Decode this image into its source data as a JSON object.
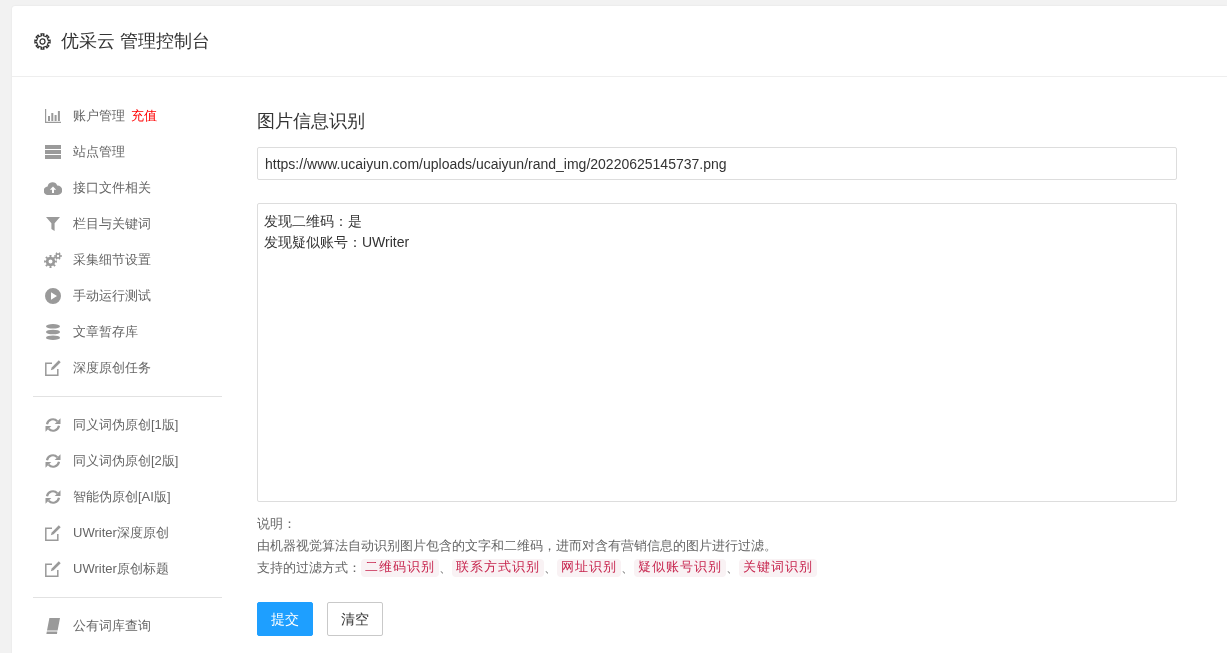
{
  "header": {
    "title": "优采云 管理控制台"
  },
  "sidebar": {
    "groups": [
      {
        "items": [
          {
            "label": "账户管理",
            "kind": "stats",
            "link": "充值"
          },
          {
            "label": "站点管理",
            "kind": "servers"
          },
          {
            "label": "接口文件相关",
            "kind": "upload"
          },
          {
            "label": "栏目与关键词",
            "kind": "filter"
          },
          {
            "label": "采集细节设置",
            "kind": "settings"
          },
          {
            "label": "手动运行测试",
            "kind": "run"
          },
          {
            "label": "文章暂存库",
            "kind": "storage"
          },
          {
            "label": "深度原创任务",
            "kind": "edit"
          }
        ]
      },
      {
        "items": [
          {
            "label": "同义词伪原创[1版]",
            "kind": "refresh"
          },
          {
            "label": "同义词伪原创[2版]",
            "kind": "refresh"
          },
          {
            "label": "智能伪原创[AI版]",
            "kind": "refresh"
          },
          {
            "label": "UWriter深度原创",
            "kind": "edit"
          },
          {
            "label": "UWriter原创标题",
            "kind": "edit"
          }
        ]
      },
      {
        "items": [
          {
            "label": "公有词库查询",
            "kind": "book"
          }
        ]
      }
    ]
  },
  "main": {
    "title": "图片信息识别",
    "url_field": {
      "value": "https://www.ucaiyun.com/uploads/ucaiyun/rand_img/20220625145737.png"
    },
    "result_box": {
      "lines": [
        "发现二维码：是",
        "发现疑似账号：UWriter"
      ]
    },
    "notes": {
      "heading": "说明：",
      "description": "由机器视觉算法自动识别图片包含的文字和二维码，进而对含有营销信息的图片进行过滤。",
      "filters_label": "支持的过滤方式：",
      "filters": [
        {
          "label": "二维码识别",
          "separator": "、"
        },
        {
          "label": "联系方式识别",
          "separator": "、"
        },
        {
          "label": "网址识别",
          "separator": "、"
        },
        {
          "label": "疑似账号识别",
          "separator": "、"
        },
        {
          "label": "关键词识别"
        }
      ]
    },
    "buttons": [
      {
        "label": "提交",
        "kind": "primary"
      },
      {
        "label": "清空",
        "kind": "default"
      }
    ]
  }
}
